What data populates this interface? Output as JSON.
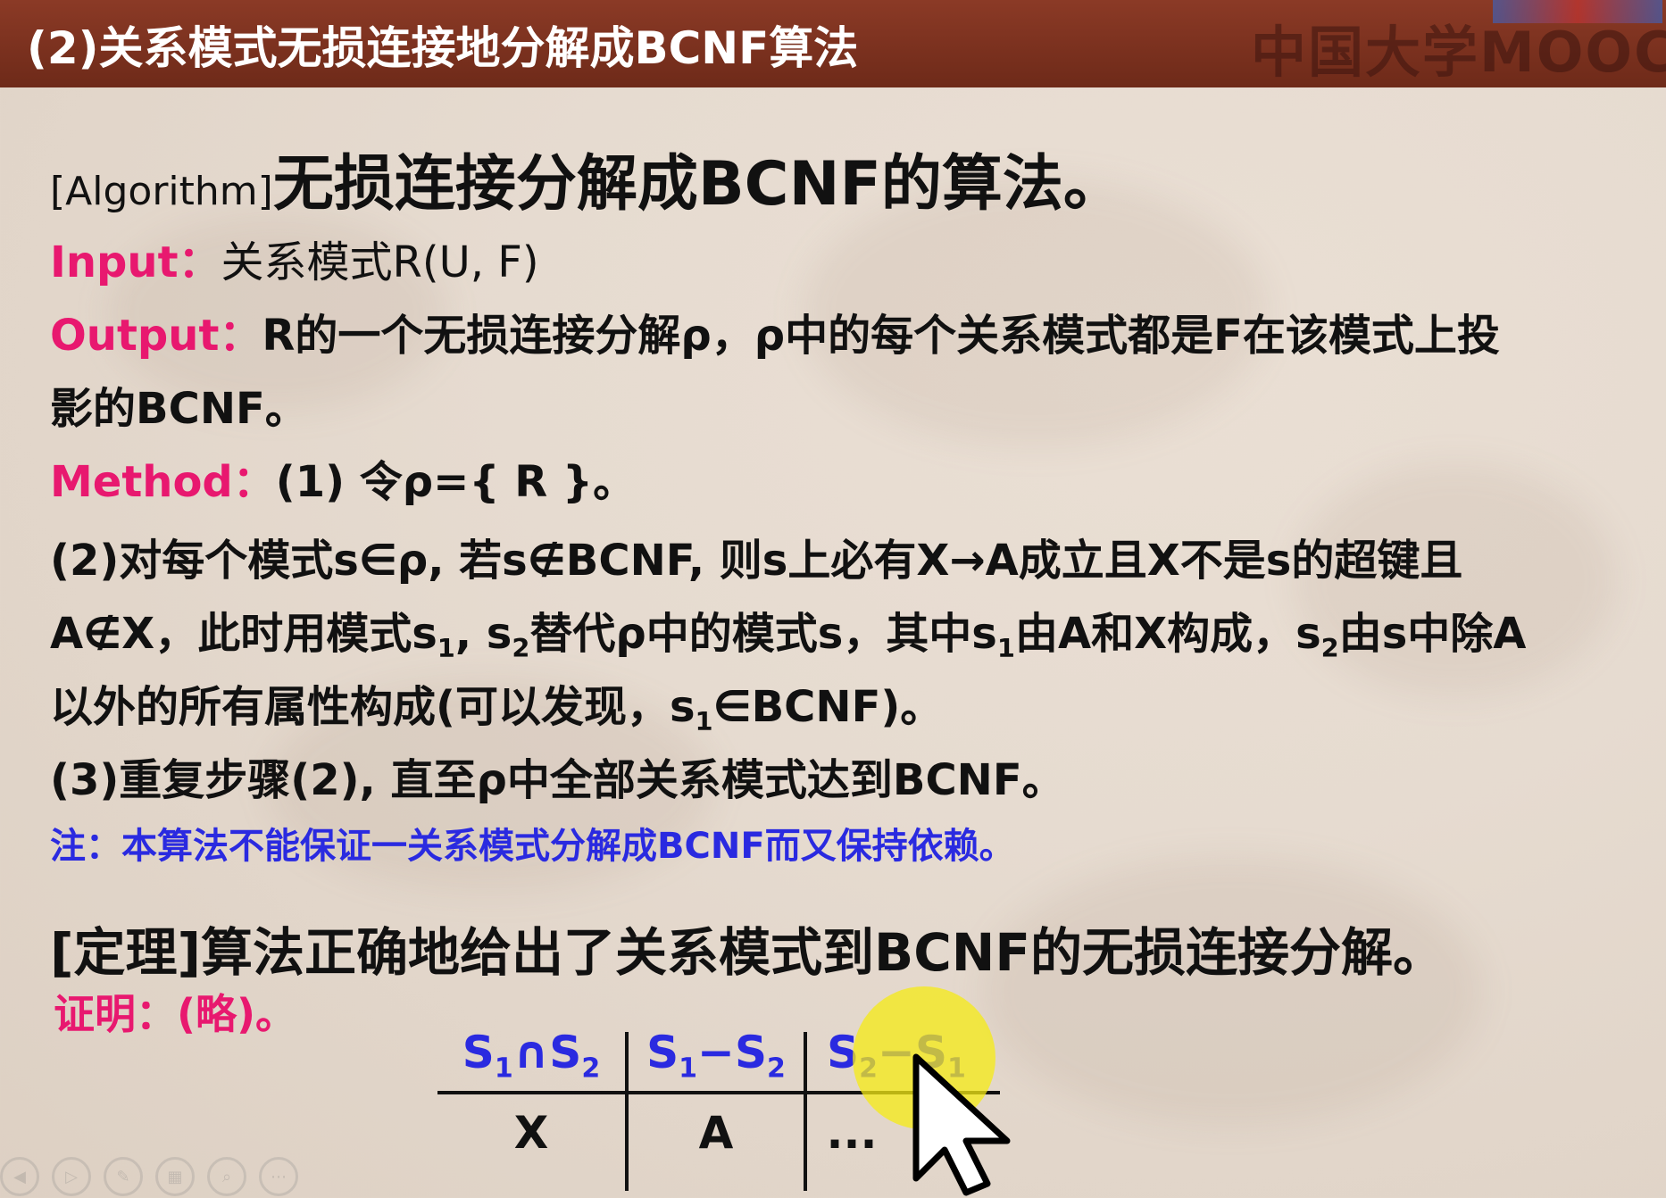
{
  "header": {
    "title": "(2)关系模式无损连接地分解成BCNF算法",
    "logo_text": "中国大学MOOC"
  },
  "algorithm": {
    "tag": "[Algorithm]",
    "title": "无损连接分解成BCNF的算法。"
  },
  "input": {
    "label": "Input：",
    "text": "关系模式R(U, F)"
  },
  "output": {
    "label": "Output：",
    "line1": "R的一个无损连接分解ρ，ρ中的每个关系模式都是F在该模式上投",
    "line2": "影的BCNF。"
  },
  "method": {
    "label": "Method：",
    "step1": "(1) 令ρ={ R }。",
    "step2_line1": "(2)对每个模式s∈ρ, 若s∉BCNF, 则s上必有X→A成立且X不是s的超键且",
    "step2_line2_a": "A∉X，此时用模式s",
    "step2_line2_b": ", s",
    "step2_line2_c": "替代ρ中的模式s，其中s",
    "step2_line2_d": "由A和X构成，s",
    "step2_line2_e": "由s中除A",
    "step2_line3_a": "以外的所有属性构成(可以发现，s",
    "step2_line3_b": "∈BCNF)。",
    "step3": "(3)重复步骤(2), 直至ρ中全部关系模式达到BCNF。",
    "sub1": "1",
    "sub2": "2"
  },
  "note": "注：本算法不能保证一关系模式分解成BCNF而又保持依赖。",
  "theorem": "[定理]算法正确地给出了关系模式到BCNF的无损连接分解。",
  "proof": "证明：(略)。",
  "table": {
    "headers": [
      {
        "main": "S",
        "sub1": "1",
        "op": "∩S",
        "sub2": "2"
      },
      {
        "main": "S",
        "sub1": "1",
        "op": "−S",
        "sub2": "2"
      },
      {
        "main": "S",
        "sub1": "2",
        "op": "−S",
        "sub2": "1"
      }
    ],
    "row": [
      "X",
      "A",
      "..."
    ]
  },
  "player": {
    "icons": [
      "back-icon",
      "play-icon",
      "pen-icon",
      "grid-icon",
      "zoom-icon",
      "more-icon"
    ]
  },
  "colors": {
    "keyword": "#e8186f",
    "note": "#2a2ae0",
    "header_bg": "#7a2f1d"
  }
}
